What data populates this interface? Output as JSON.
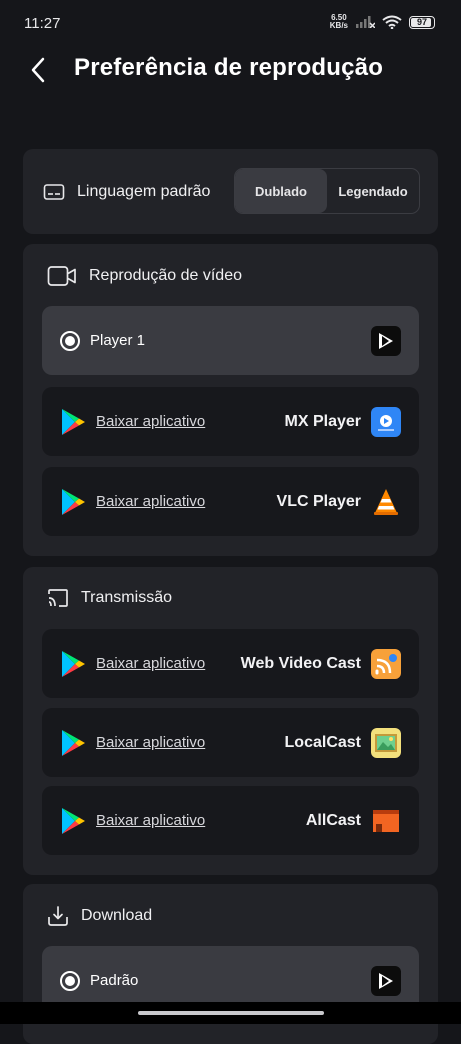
{
  "status": {
    "time": "11:27",
    "net_speed_value": "6.50",
    "net_speed_unit": "KB/s",
    "battery": "97"
  },
  "header": {
    "title": "Preferência de reprodução"
  },
  "language": {
    "label": "Linguagem padrão",
    "options": [
      "Dublado",
      "Legendado"
    ],
    "selected": "Dublado"
  },
  "video": {
    "label": "Reprodução de vídeo",
    "rows": [
      {
        "text": "Player 1",
        "selected": true,
        "icon": "player1-app-icon"
      },
      {
        "link": "Baixar aplicativo",
        "app": "MX Player",
        "icon": "mx-player-app-icon"
      },
      {
        "link": "Baixar aplicativo",
        "app": "VLC Player",
        "icon": "vlc-app-icon"
      }
    ]
  },
  "cast": {
    "label": "Transmissão",
    "rows": [
      {
        "link": "Baixar aplicativo",
        "app": "Web Video Cast",
        "icon": "web-video-cast-app-icon"
      },
      {
        "link": "Baixar aplicativo",
        "app": "LocalCast",
        "icon": "localcast-app-icon"
      },
      {
        "link": "Baixar aplicativo",
        "app": "AllCast",
        "icon": "allcast-app-icon"
      }
    ]
  },
  "download": {
    "label": "Download",
    "rows": [
      {
        "text": "Padrão",
        "selected": true,
        "icon": "player1-app-icon"
      }
    ]
  },
  "colors": {
    "background": "#15161a",
    "card": "#222328",
    "row": "#17181c",
    "selected_row": "#3a3b41"
  }
}
